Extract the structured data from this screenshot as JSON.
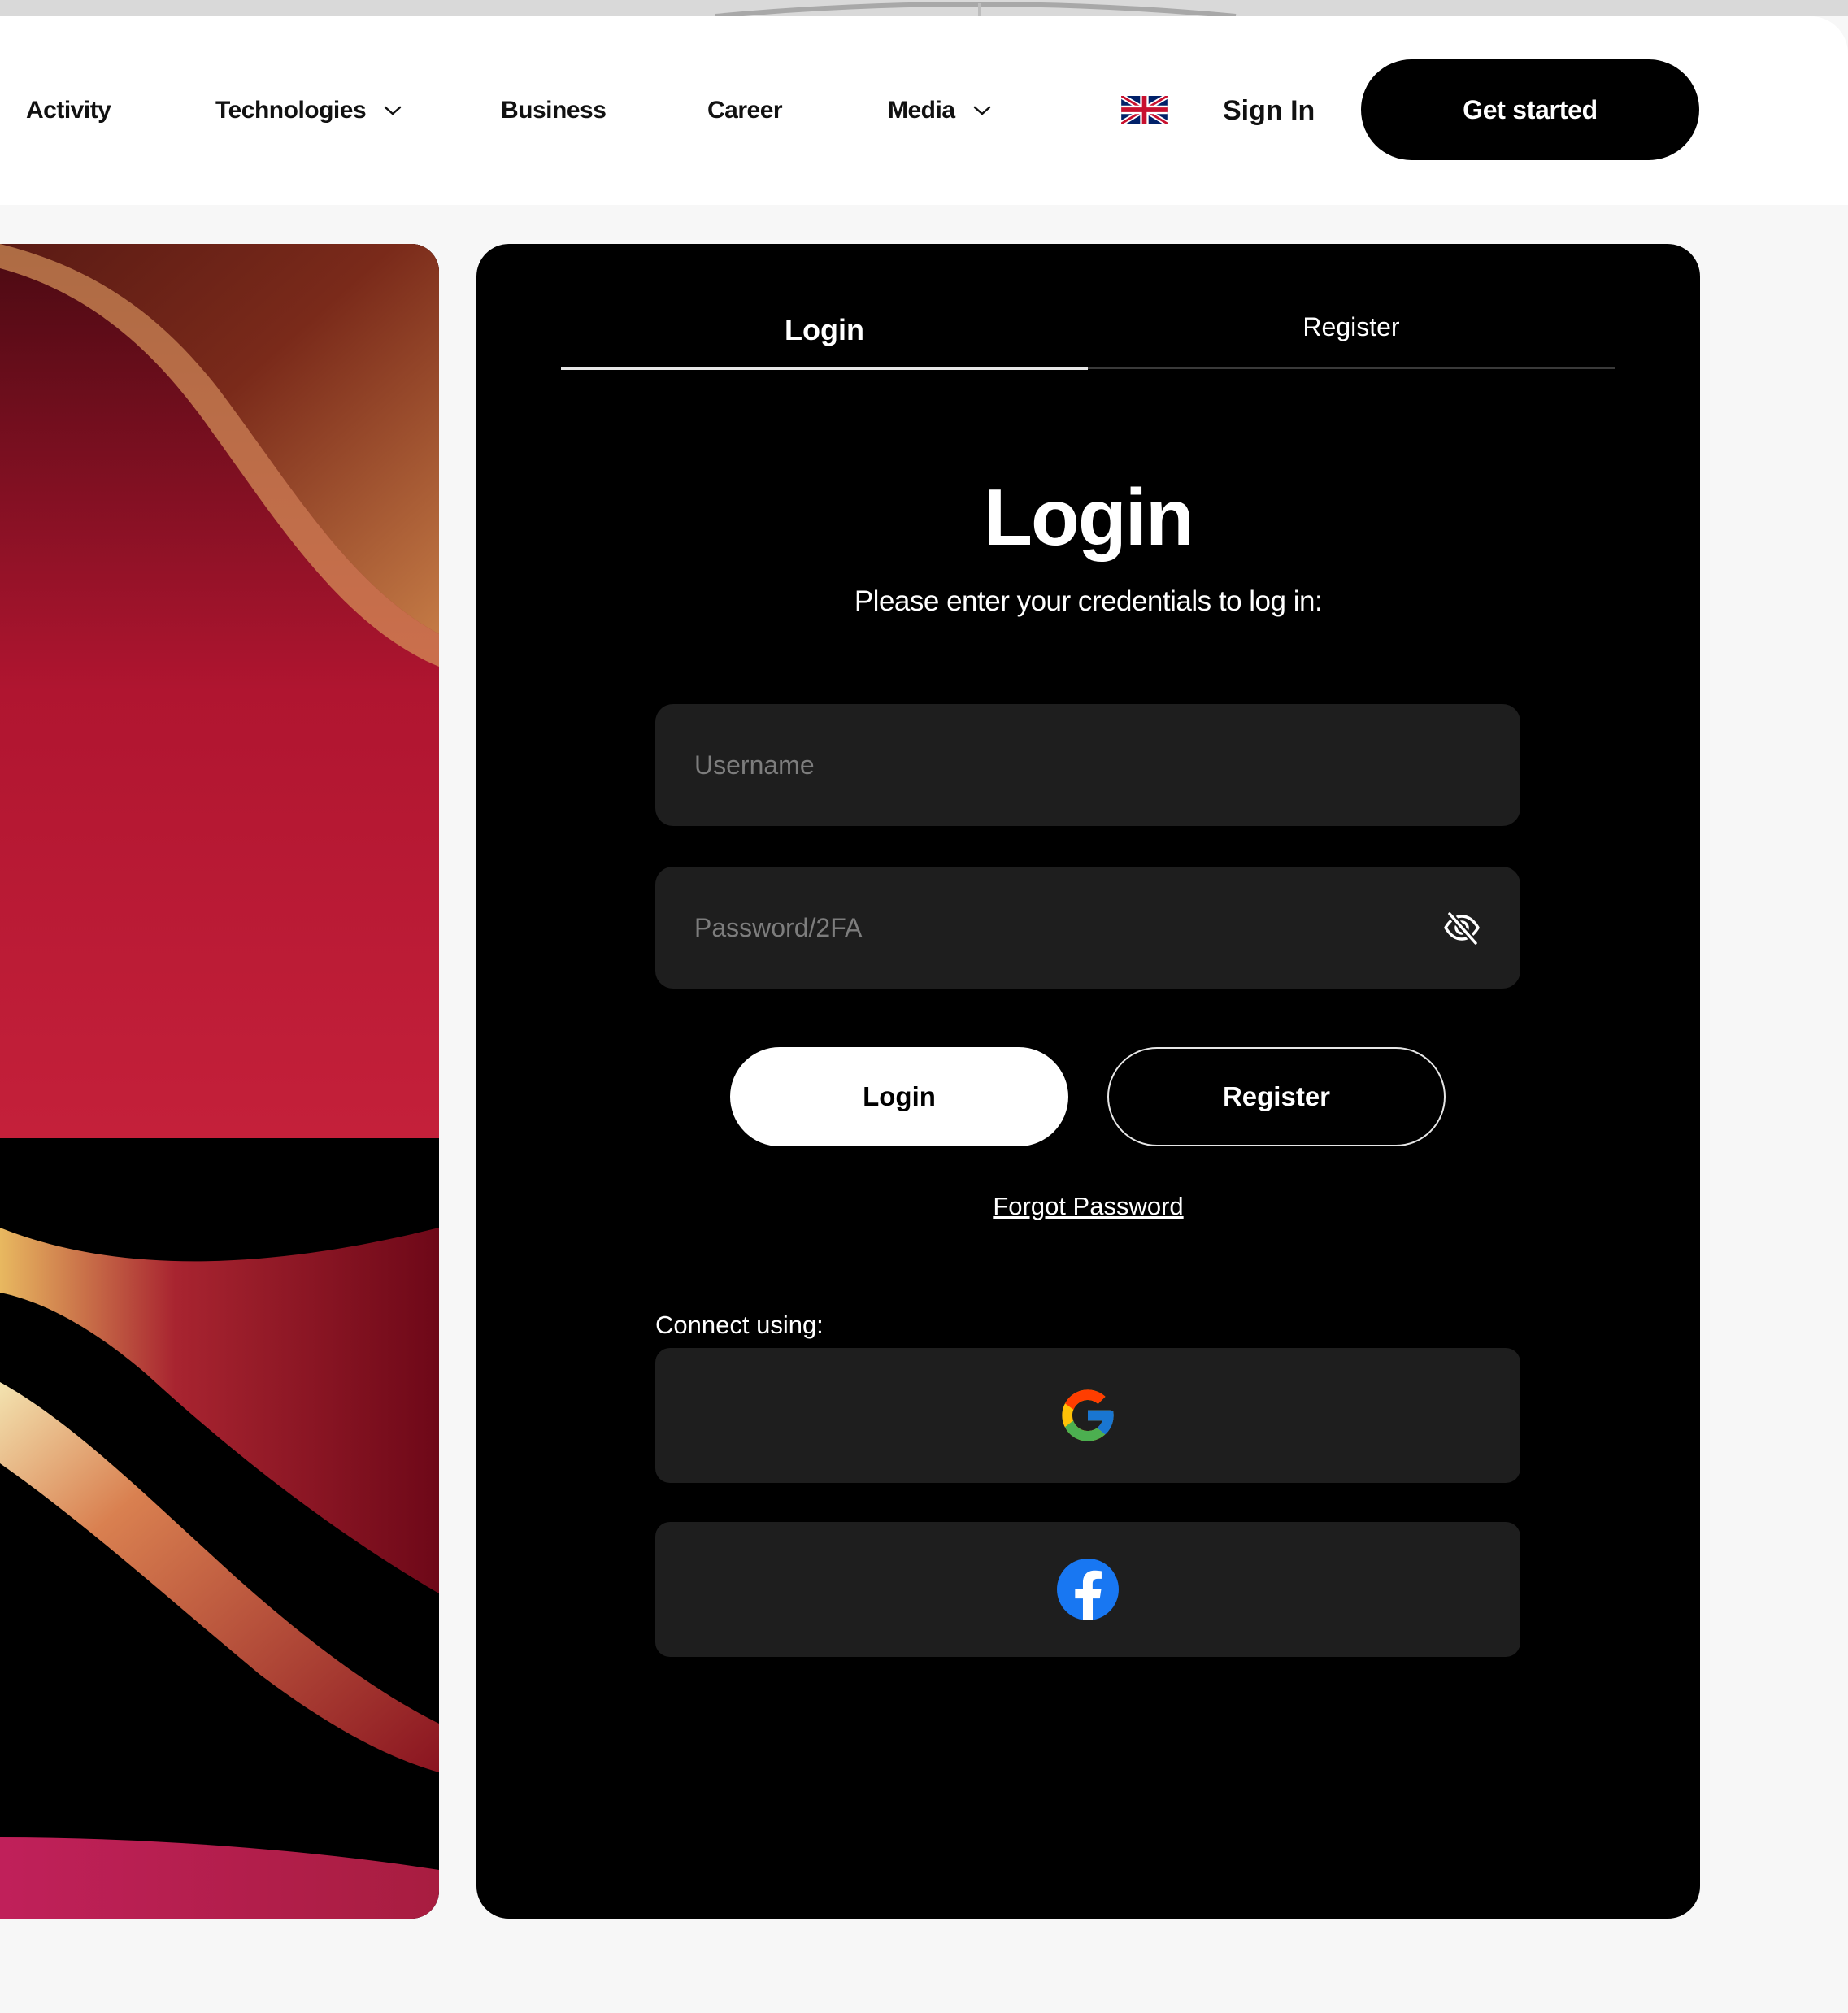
{
  "nav": {
    "items": [
      {
        "label": "Activity",
        "has_dropdown": false
      },
      {
        "label": "Technologies",
        "has_dropdown": true
      },
      {
        "label": "Business",
        "has_dropdown": false
      },
      {
        "label": "Career",
        "has_dropdown": false
      },
      {
        "label": "Media",
        "has_dropdown": true
      }
    ],
    "language_icon": "uk-flag-icon",
    "sign_in_label": "Sign In",
    "cta_label": "Get started"
  },
  "panel": {
    "tabs": [
      {
        "label": "Login",
        "active": true
      },
      {
        "label": "Register",
        "active": false
      }
    ],
    "title": "Login",
    "subtitle": "Please enter your credentials to log in:",
    "username": {
      "value": "",
      "placeholder": "Username"
    },
    "password": {
      "value": "",
      "placeholder": "Password/2FA",
      "toggle_icon": "eye-off-icon"
    },
    "login_button": "Login",
    "register_button": "Register",
    "forgot_password": "Forgot Password",
    "connect_label": "Connect using:",
    "social_providers": [
      {
        "provider": "google",
        "icon": "google-icon"
      },
      {
        "provider": "facebook",
        "icon": "facebook-icon"
      }
    ]
  },
  "colors": {
    "panel_bg": "#000000",
    "field_bg": "#1e1e1e",
    "page_bg": "#f7f7f7",
    "facebook_blue": "#1877f2"
  }
}
